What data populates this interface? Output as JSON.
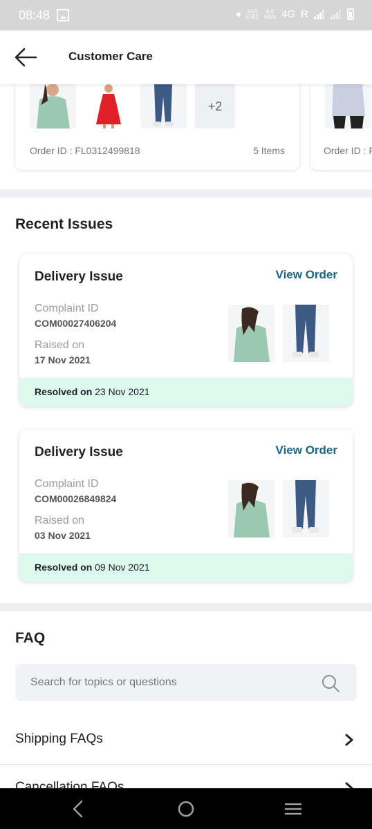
{
  "status_bar": {
    "time": "08:48",
    "volte": "Vo))",
    "lte2": "LTE2",
    "speed": "6.0",
    "speed_unit": "KB/s",
    "network": "4G",
    "roaming": "R"
  },
  "header": {
    "title": "Customer Care"
  },
  "orders": [
    {
      "order_id": "Order ID : FL0312499818",
      "items_count": "5 Items",
      "more_label": "+2"
    },
    {
      "order_id": "Order ID : F"
    }
  ],
  "recent_issues": {
    "title": "Recent Issues",
    "items": [
      {
        "issue_title": "Delivery Issue",
        "view_order_label": "View Order",
        "complaint_label": "Complaint ID",
        "complaint_id": "COM00027406204",
        "raised_label": "Raised on",
        "raised_on": "17 Nov 2021",
        "resolved_label": "Resolved on",
        "resolved_on": "23 Nov 2021"
      },
      {
        "issue_title": "Delivery Issue",
        "view_order_label": "View Order",
        "complaint_label": "Complaint ID",
        "complaint_id": "COM00026849824",
        "raised_label": "Raised on",
        "raised_on": "03 Nov 2021",
        "resolved_label": "Resolved on",
        "resolved_on": "09 Nov 2021"
      }
    ]
  },
  "faq": {
    "title": "FAQ",
    "search_placeholder": "Search for topics or questions",
    "items": [
      {
        "label": "Shipping FAQs"
      },
      {
        "label": "Cancellation FAQs"
      }
    ]
  },
  "colors": {
    "accent": "#1b6382",
    "resolved_bg": "#dcf9ee",
    "divider": "#eff0f3"
  }
}
